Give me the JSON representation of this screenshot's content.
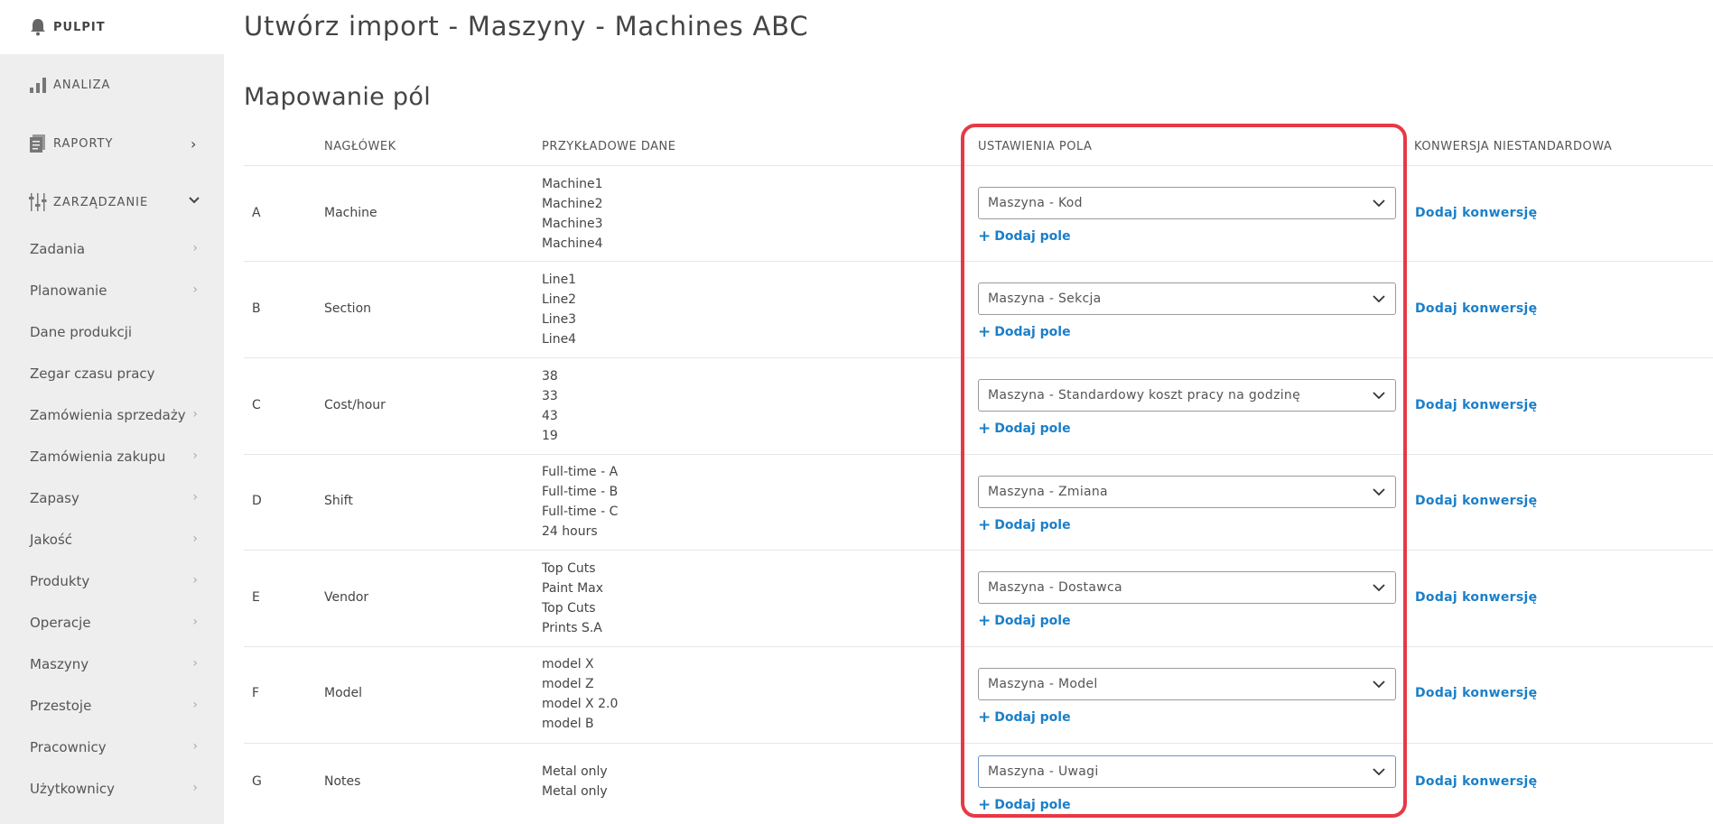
{
  "sidebar": {
    "main": [
      {
        "label": "PULPIT"
      },
      {
        "label": "ANALIZA"
      },
      {
        "label": "RAPORTY"
      },
      {
        "label": "ZARZĄDZANIE"
      }
    ],
    "items": [
      {
        "label": "Zadania"
      },
      {
        "label": "Planowanie"
      },
      {
        "label": "Dane produkcji"
      },
      {
        "label": "Zegar czasu pracy"
      },
      {
        "label": "Zamówienia sprzedaży"
      },
      {
        "label": "Zamówienia zakupu"
      },
      {
        "label": "Zapasy"
      },
      {
        "label": "Jakość"
      },
      {
        "label": "Produkty"
      },
      {
        "label": "Operacje"
      },
      {
        "label": "Maszyny"
      },
      {
        "label": "Przestoje"
      },
      {
        "label": "Pracownicy"
      },
      {
        "label": "Użytkownicy"
      }
    ]
  },
  "page": {
    "title": "Utwórz import - Maszyny - Machines ABC",
    "section_title": "Mapowanie pól"
  },
  "table": {
    "headers": {
      "header": "NAGŁÓWEK",
      "sample": "PRZYKŁADOWE DANE",
      "settings": "USTAWIENIA POLA",
      "conversion": "KONWERSJA NIESTANDARDOWA"
    },
    "add_field_label": "Dodaj pole",
    "add_conversion_label": "Dodaj konwersję",
    "rows": [
      {
        "letter": "A",
        "header": "Machine",
        "samples": [
          "Machine1",
          "Machine2",
          "Machine3",
          "Machine4"
        ],
        "field": "Maszyna - Kod"
      },
      {
        "letter": "B",
        "header": "Section",
        "samples": [
          "Line1",
          "Line2",
          "Line3",
          "Line4"
        ],
        "field": "Maszyna - Sekcja"
      },
      {
        "letter": "C",
        "header": "Cost/hour",
        "samples": [
          "38",
          "33",
          "43",
          "19"
        ],
        "field": "Maszyna - Standardowy koszt pracy na godzinę"
      },
      {
        "letter": "D",
        "header": "Shift",
        "samples": [
          "Full-time - A",
          "Full-time - B",
          "Full-time - C",
          "24 hours"
        ],
        "field": "Maszyna - Zmiana"
      },
      {
        "letter": "E",
        "header": "Vendor",
        "samples": [
          "Top Cuts",
          "Paint Max",
          "Top Cuts",
          "Prints S.A"
        ],
        "field": "Maszyna - Dostawca"
      },
      {
        "letter": "F",
        "header": "Model",
        "samples": [
          "model X",
          "model Z",
          "model X 2.0",
          "model B"
        ],
        "field": "Maszyna - Model"
      },
      {
        "letter": "G",
        "header": "Notes",
        "samples": [
          "Metal only",
          "Metal only"
        ],
        "field": "Maszyna - Uwagi"
      }
    ]
  },
  "colors": {
    "accent": "#1a7fc9",
    "highlight": "#e63946",
    "sidebar_bg": "#eeeeee"
  }
}
